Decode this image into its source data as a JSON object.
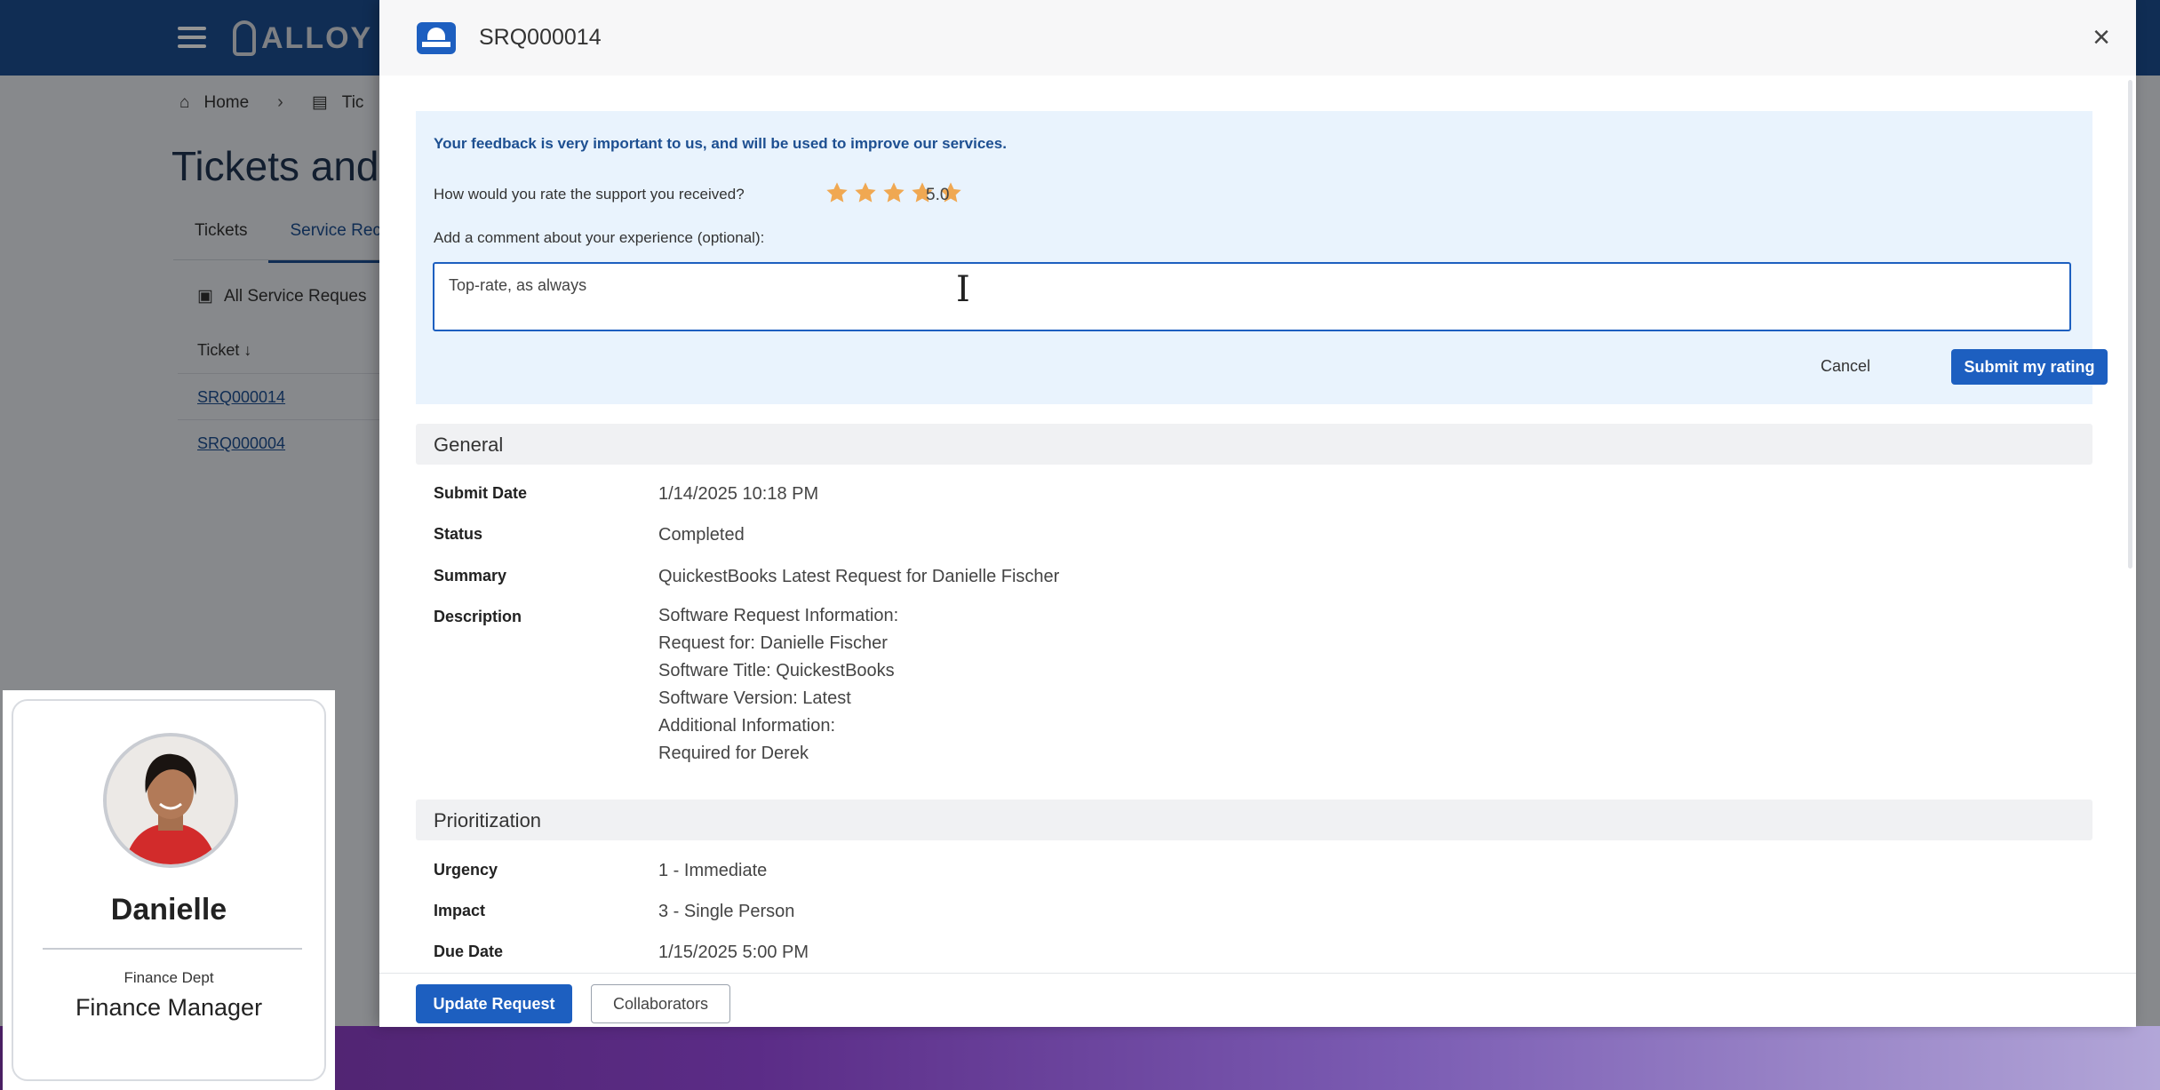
{
  "background_app": {
    "logo_text": "ALLOY",
    "breadcrumb": [
      "Home",
      "Tic"
    ],
    "page_title": "Tickets and",
    "tabs": [
      "Tickets",
      "Service Rec"
    ],
    "list_title": "All Service Reques",
    "column_header": "Ticket",
    "rows": [
      "SRQ000014",
      "SRQ000004"
    ]
  },
  "drawer": {
    "title": "SRQ000014",
    "feedback": {
      "heading": "Your feedback is very important to us, and will be used to improve our services.",
      "rating_question": "How would you rate the support you received?",
      "rating_stars": 5,
      "rating_value": "5.0",
      "comment_label": "Add a comment about your experience (optional):",
      "comment_value": "Top-rate, as always",
      "cancel_label": "Cancel",
      "submit_label": "Submit my rating"
    },
    "general": {
      "heading": "General",
      "fields": [
        {
          "label": "Submit Date",
          "value": "1/14/2025 10:18 PM"
        },
        {
          "label": "Status",
          "value": "Completed"
        },
        {
          "label": "Summary",
          "value": "QuickestBooks Latest Request for Danielle Fischer"
        },
        {
          "label": "Description",
          "lines": [
            "Software Request Information:",
            "Request for: Danielle Fischer",
            "Software Title: QuickestBooks",
            "Software Version: Latest",
            "Additional Information:",
            "Required for Derek"
          ]
        }
      ]
    },
    "prioritization": {
      "heading": "Prioritization",
      "fields": [
        {
          "label": "Urgency",
          "value": "1 - Immediate"
        },
        {
          "label": "Impact",
          "value": "3 - Single Person"
        },
        {
          "label": "Due Date",
          "value": "1/15/2025 5:00 PM"
        }
      ]
    },
    "footer": {
      "update_label": "Update Request",
      "collaborators_label": "Collaborators"
    }
  },
  "profile": {
    "name": "Danielle",
    "dept": "Finance Dept",
    "role": "Finance Manager"
  },
  "colors": {
    "primary": "#1d5fc0",
    "topbar": "#1d4f91",
    "star": "#f0a852",
    "feedback_bg": "#e9f3fd"
  }
}
